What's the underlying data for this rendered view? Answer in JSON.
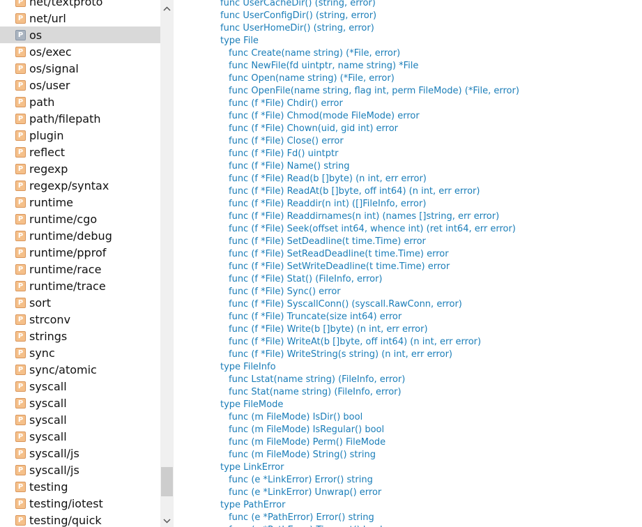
{
  "packages": [
    {
      "label": "net/textproto",
      "icon": "P",
      "selected": false
    },
    {
      "label": "net/url",
      "icon": "P",
      "selected": false
    },
    {
      "label": "os",
      "icon": "P",
      "selected": true
    },
    {
      "label": "os/exec",
      "icon": "P",
      "selected": false
    },
    {
      "label": "os/signal",
      "icon": "P",
      "selected": false
    },
    {
      "label": "os/user",
      "icon": "P",
      "selected": false
    },
    {
      "label": "path",
      "icon": "P",
      "selected": false
    },
    {
      "label": "path/filepath",
      "icon": "P",
      "selected": false
    },
    {
      "label": "plugin",
      "icon": "P",
      "selected": false
    },
    {
      "label": "reflect",
      "icon": "P",
      "selected": false
    },
    {
      "label": "regexp",
      "icon": "P",
      "selected": false
    },
    {
      "label": "regexp/syntax",
      "icon": "P",
      "selected": false
    },
    {
      "label": "runtime",
      "icon": "P",
      "selected": false
    },
    {
      "label": "runtime/cgo",
      "icon": "P",
      "selected": false
    },
    {
      "label": "runtime/debug",
      "icon": "P",
      "selected": false
    },
    {
      "label": "runtime/pprof",
      "icon": "P",
      "selected": false
    },
    {
      "label": "runtime/race",
      "icon": "P",
      "selected": false
    },
    {
      "label": "runtime/trace",
      "icon": "P",
      "selected": false
    },
    {
      "label": "sort",
      "icon": "P",
      "selected": false
    },
    {
      "label": "strconv",
      "icon": "P",
      "selected": false
    },
    {
      "label": "strings",
      "icon": "P",
      "selected": false
    },
    {
      "label": "sync",
      "icon": "P",
      "selected": false
    },
    {
      "label": "sync/atomic",
      "icon": "P",
      "selected": false
    },
    {
      "label": "syscall",
      "icon": "P",
      "selected": false
    },
    {
      "label": "syscall",
      "icon": "P",
      "selected": false
    },
    {
      "label": "syscall",
      "icon": "P",
      "selected": false
    },
    {
      "label": "syscall",
      "icon": "P",
      "selected": false
    },
    {
      "label": "syscall/js",
      "icon": "P",
      "selected": false
    },
    {
      "label": "syscall/js",
      "icon": "P",
      "selected": false
    },
    {
      "label": "testing",
      "icon": "P",
      "selected": false
    },
    {
      "label": "testing/iotest",
      "icon": "P",
      "selected": false
    },
    {
      "label": "testing/quick",
      "icon": "P",
      "selected": false
    }
  ],
  "scrollbar": {
    "up_icon": "chevron-up-icon",
    "down_icon": "chevron-down-icon"
  },
  "doc_lines": [
    {
      "text": "func UserCacheDir() (string, error)",
      "indent": false
    },
    {
      "text": "func UserConfigDir() (string, error)",
      "indent": false
    },
    {
      "text": "func UserHomeDir() (string, error)",
      "indent": false
    },
    {
      "text": "type File",
      "indent": false
    },
    {
      "text": "func Create(name string) (*File, error)",
      "indent": true
    },
    {
      "text": "func NewFile(fd uintptr, name string) *File",
      "indent": true
    },
    {
      "text": "func Open(name string) (*File, error)",
      "indent": true
    },
    {
      "text": "func OpenFile(name string, flag int, perm FileMode) (*File, error)",
      "indent": true
    },
    {
      "text": "func (f *File) Chdir() error",
      "indent": true
    },
    {
      "text": "func (f *File) Chmod(mode FileMode) error",
      "indent": true
    },
    {
      "text": "func (f *File) Chown(uid, gid int) error",
      "indent": true
    },
    {
      "text": "func (f *File) Close() error",
      "indent": true
    },
    {
      "text": "func (f *File) Fd() uintptr",
      "indent": true
    },
    {
      "text": "func (f *File) Name() string",
      "indent": true
    },
    {
      "text": "func (f *File) Read(b []byte) (n int, err error)",
      "indent": true
    },
    {
      "text": "func (f *File) ReadAt(b []byte, off int64) (n int, err error)",
      "indent": true
    },
    {
      "text": "func (f *File) Readdir(n int) ([]FileInfo, error)",
      "indent": true
    },
    {
      "text": "func (f *File) Readdirnames(n int) (names []string, err error)",
      "indent": true
    },
    {
      "text": "func (f *File) Seek(offset int64, whence int) (ret int64, err error)",
      "indent": true
    },
    {
      "text": "func (f *File) SetDeadline(t time.Time) error",
      "indent": true
    },
    {
      "text": "func (f *File) SetReadDeadline(t time.Time) error",
      "indent": true
    },
    {
      "text": "func (f *File) SetWriteDeadline(t time.Time) error",
      "indent": true
    },
    {
      "text": "func (f *File) Stat() (FileInfo, error)",
      "indent": true
    },
    {
      "text": "func (f *File) Sync() error",
      "indent": true
    },
    {
      "text": "func (f *File) SyscallConn() (syscall.RawConn, error)",
      "indent": true
    },
    {
      "text": "func (f *File) Truncate(size int64) error",
      "indent": true
    },
    {
      "text": "func (f *File) Write(b []byte) (n int, err error)",
      "indent": true
    },
    {
      "text": "func (f *File) WriteAt(b []byte, off int64) (n int, err error)",
      "indent": true
    },
    {
      "text": "func (f *File) WriteString(s string) (n int, err error)",
      "indent": true
    },
    {
      "text": "type FileInfo",
      "indent": false
    },
    {
      "text": "func Lstat(name string) (FileInfo, error)",
      "indent": true
    },
    {
      "text": "func Stat(name string) (FileInfo, error)",
      "indent": true
    },
    {
      "text": "type FileMode",
      "indent": false
    },
    {
      "text": "func (m FileMode) IsDir() bool",
      "indent": true
    },
    {
      "text": "func (m FileMode) IsRegular() bool",
      "indent": true
    },
    {
      "text": "func (m FileMode) Perm() FileMode",
      "indent": true
    },
    {
      "text": "func (m FileMode) String() string",
      "indent": true
    },
    {
      "text": "type LinkError",
      "indent": false
    },
    {
      "text": "func (e *LinkError) Error() string",
      "indent": true
    },
    {
      "text": "func (e *LinkError) Unwrap() error",
      "indent": true
    },
    {
      "text": "type PathError",
      "indent": false
    },
    {
      "text": "func (e *PathError) Error() string",
      "indent": true
    },
    {
      "text": "func (e *PathError) Timeout() bool",
      "indent": true
    }
  ]
}
